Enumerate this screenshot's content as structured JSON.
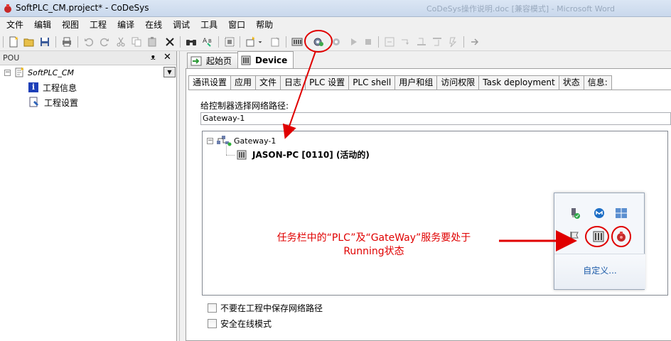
{
  "window": {
    "title": "SoftPLC_CM.project* - CoDeSys",
    "background_title": "CoDeSys操作说明.doc [兼容模式] - Microsoft Word"
  },
  "menu": [
    "文件",
    "编辑",
    "视图",
    "工程",
    "编译",
    "在线",
    "调试",
    "工具",
    "窗口",
    "帮助"
  ],
  "pou_panel": {
    "title": "POU",
    "pin": "ᴥ",
    "close": "✕",
    "root": "SoftPLC_CM",
    "items": [
      "工程信息",
      "工程设置"
    ]
  },
  "doc_tabs": [
    {
      "label": "起始页",
      "active": false
    },
    {
      "label": "Device",
      "active": true
    }
  ],
  "sub_tabs": [
    "通讯设置",
    "应用",
    "文件",
    "日志",
    "PLC 设置",
    "PLC shell",
    "用户和组",
    "访问权限",
    "Task deployment",
    "状态",
    "信息:"
  ],
  "comm": {
    "path_label": "给控制器选择网络路径:",
    "path_value": "Gateway-1",
    "gateway_node": "Gateway-1",
    "device_node": "JASON-PC [0110] (活动的)"
  },
  "tray": {
    "customize": "自定义..."
  },
  "annotation": {
    "line1": "任务栏中的“PLC”及“GateWay”服务要处于",
    "line2": "Running状态"
  },
  "options": {
    "no_save_path": "不要在工程中保存网络路径",
    "secure_online": "安全在线模式"
  },
  "colors": {
    "annotation": "#e00000",
    "accent_blue": "#1d3fb8"
  }
}
